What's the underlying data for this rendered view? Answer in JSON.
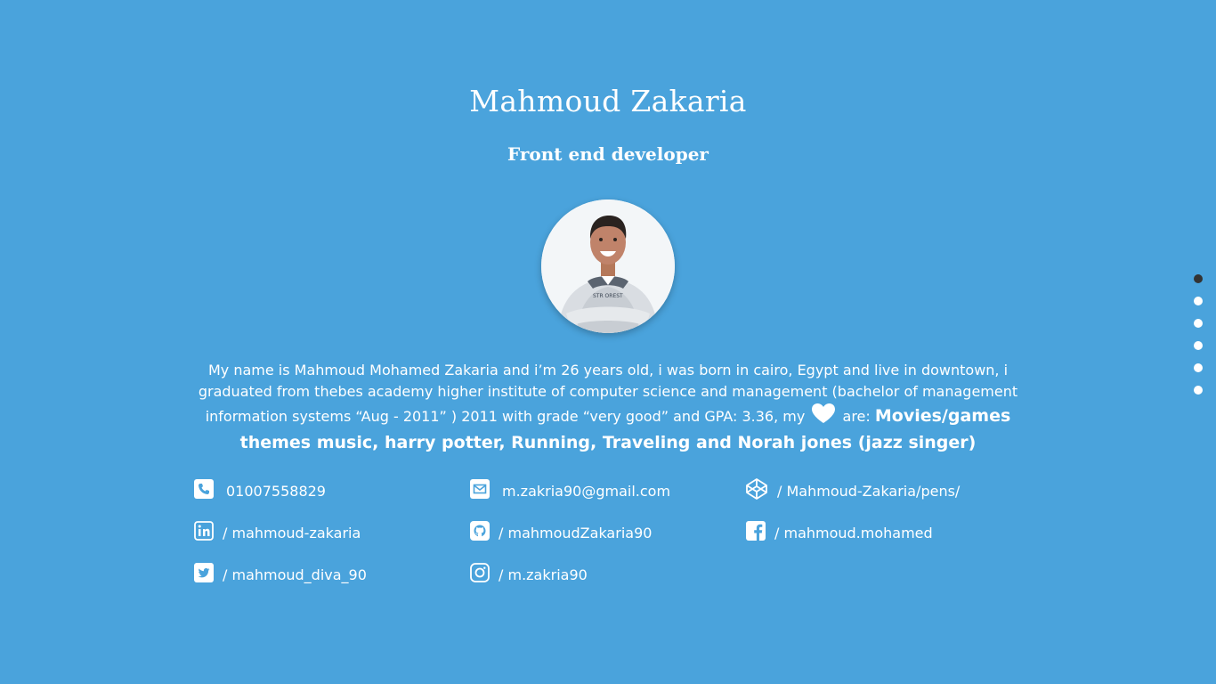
{
  "profile": {
    "name": "Mahmoud Zakaria",
    "role": "Front end developer"
  },
  "bio": {
    "text": "My name is Mahmoud Mohamed Zakaria and i’m 26 years old, i was born in cairo, Egypt and live in downtown, i graduated from thebes academy higher institute of computer science and management (bachelor of management information systems “Aug - 2011” ) 2011 with grade “very good” and GPA: 3.36, my",
    "after_heart": "are:",
    "loves": "Movies/games themes music,  harry potter,  Running,  Traveling and Norah jones (jazz singer)",
    "heart_icon": "heart-icon"
  },
  "contacts": [
    {
      "icon": "phone-icon",
      "text": "01007558829"
    },
    {
      "icon": "email-icon",
      "text": "m.zakria90@gmail.com"
    },
    {
      "icon": "codepen-icon",
      "text": "/ Mahmoud-Zakaria/pens/"
    },
    {
      "icon": "linkedin-icon",
      "text": "/ mahmoud-zakaria"
    },
    {
      "icon": "github-icon",
      "text": "/ mahmoudZakaria90"
    },
    {
      "icon": "facebook-icon",
      "text": "/ mahmoud.mohamed"
    },
    {
      "icon": "twitter-icon",
      "text": "/ mahmoud_diva_90"
    },
    {
      "icon": "instagram-icon",
      "text": "/ m.zakria90"
    }
  ],
  "nav_dots": {
    "count": 6,
    "active_index": 0
  },
  "colors": {
    "background": "#4aa3dc",
    "text": "#ffffff",
    "active_dot": "#333333"
  }
}
